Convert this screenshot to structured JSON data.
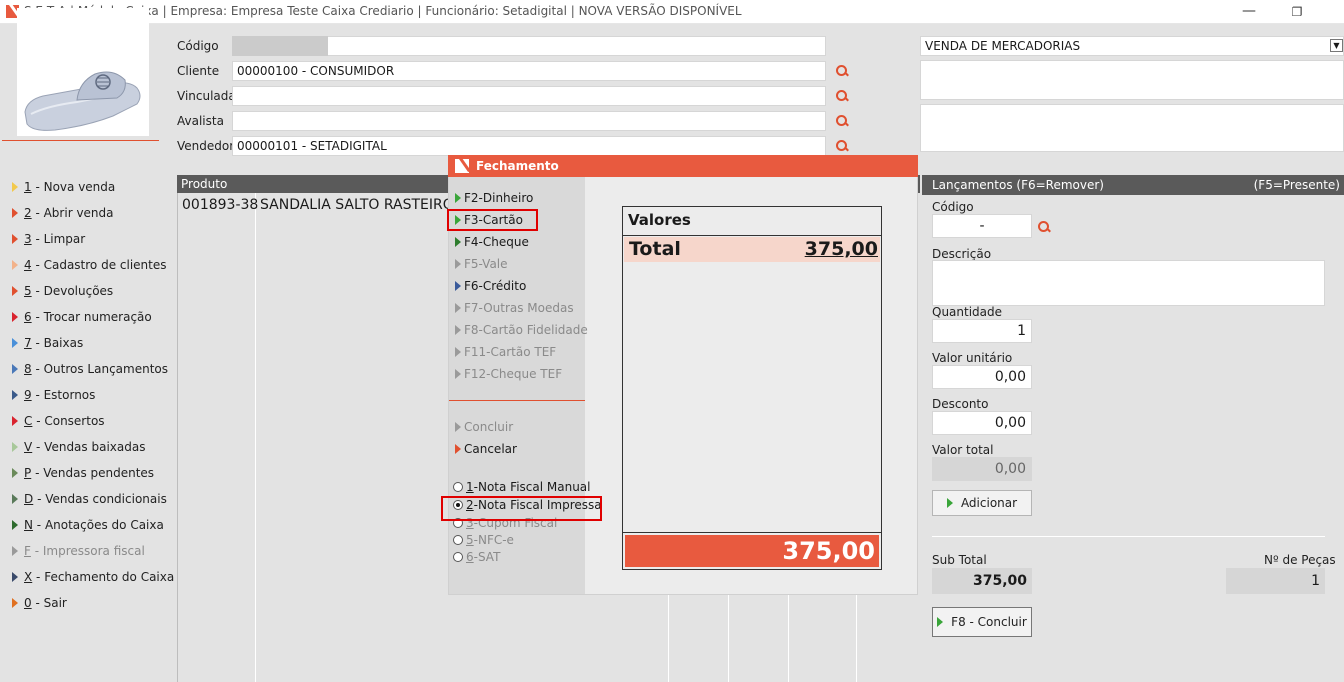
{
  "window": {
    "title": "S E T A | Módulo Caixa | Empresa: Empresa Teste Caixa Crediario | Funcionário: Setadigital  |  NOVA  VERSÃO  DISPONÍVEL",
    "minimize_glyph": "—",
    "restore_glyph": "❐"
  },
  "sidebar": {
    "items": [
      {
        "key": "1",
        "label": " - Nova venda",
        "color": "#f2c94c"
      },
      {
        "key": "2",
        "label": " - Abrir venda",
        "color": "#e0502f"
      },
      {
        "key": "3",
        "label": " - Limpar",
        "color": "#e0502f"
      },
      {
        "key": "4",
        "label": " - Cadastro de clientes",
        "color": "#f2b28a"
      },
      {
        "key": "5",
        "label": " - Devoluções",
        "color": "#e0502f"
      },
      {
        "key": "6",
        "label": " - Trocar numeração",
        "color": "#d9232e"
      },
      {
        "key": "7",
        "label": " - Baixas",
        "color": "#4a90d9"
      },
      {
        "key": "8",
        "label": " - Outros Lançamentos",
        "color": "#4a78b8"
      },
      {
        "key": "9",
        "label": " - Estornos",
        "color": "#3a5a8a"
      },
      {
        "key": "C",
        "label": " - Consertos",
        "color": "#d9232e"
      },
      {
        "key": "V",
        "label": " - Vendas baixadas",
        "color": "#a8c89a"
      },
      {
        "key": "P",
        "label": " - Vendas pendentes",
        "color": "#6a8a5a"
      },
      {
        "key": "D",
        "label": " - Vendas condicionais",
        "color": "#5a7a5a"
      },
      {
        "key": "N",
        "label": " - Anotações do Caixa",
        "color": "#2e6b2e"
      },
      {
        "key": "F",
        "label": " - Impressora fiscal",
        "color": "#9a9a9a",
        "disabled": true
      },
      {
        "key": "X",
        "label": " - Fechamento do Caixa",
        "color": "#3a4a6a"
      },
      {
        "key": "0",
        "label": " - Sair",
        "color": "#e07020"
      }
    ]
  },
  "form": {
    "codigo_label": "Código",
    "cliente_label": "Cliente",
    "cliente_value": "00000100 - CONSUMIDOR",
    "vinculada_label": "Vinculada",
    "avalista_label": "Avalista",
    "vendedor_label": "Vendedor",
    "vendedor_value": "00000101 - SETADIGITAL",
    "venda_tipo": "VENDA DE MERCADORIAS"
  },
  "grid": {
    "header": "Produto",
    "rows": [
      {
        "code": "001893-38",
        "description": "SANDALIA SALTO RASTEIRO"
      }
    ]
  },
  "lancamentos": {
    "header_left": "Lançamentos (F6=Remover)",
    "header_right": "(F5=Presente)",
    "codigo_label": "Código",
    "codigo_value": "-",
    "descricao_label": "Descrição",
    "quantidade_label": "Quantidade",
    "quantidade_value": "1",
    "valor_unitario_label": "Valor unitário",
    "valor_unitario_value": "0,00",
    "desconto_label": "Desconto",
    "desconto_value": "0,00",
    "valor_total_label": "Valor total",
    "valor_total_value": "0,00",
    "adicionar_label": "Adicionar",
    "subtotal_label": "Sub Total",
    "subtotal_value": "375,00",
    "pecas_label": "Nº de Peças",
    "pecas_value": "1",
    "concluir_label": "F8 - Concluir"
  },
  "modal": {
    "title": "Fechamento",
    "payments": [
      {
        "label": "F2-Dinheiro",
        "color": "#3aa53a",
        "disabled": false
      },
      {
        "label": "F3-Cartão",
        "color": "#3aa53a",
        "disabled": false
      },
      {
        "label": "F4-Cheque",
        "color": "#2e7d2e",
        "disabled": false
      },
      {
        "label": "F5-Vale",
        "color": "#9a9a9a",
        "disabled": true
      },
      {
        "label": "F6-Crédito",
        "color": "#3a5a9a",
        "disabled": false
      },
      {
        "label": "F7-Outras Moedas",
        "color": "#9a9a9a",
        "disabled": true
      },
      {
        "label": "F8-Cartão Fidelidade",
        "color": "#9a9a9a",
        "disabled": true
      },
      {
        "label": "F11-Cartão TEF",
        "color": "#9a9a9a",
        "disabled": true
      },
      {
        "label": "F12-Cheque TEF",
        "color": "#9a9a9a",
        "disabled": true
      }
    ],
    "concluir_label": "Concluir",
    "cancelar_label": "Cancelar",
    "doc_options": [
      {
        "key": "1",
        "label": "-Nota Fiscal Manual",
        "checked": false,
        "disabled": false
      },
      {
        "key": "2",
        "label": "-Nota Fiscal Impressa",
        "checked": true,
        "disabled": false
      },
      {
        "key": "3",
        "label": "-Cupom Fiscal",
        "checked": false,
        "disabled": true
      },
      {
        "key": "5",
        "label": "-NFC-e",
        "checked": false,
        "disabled": true
      },
      {
        "key": "6",
        "label": "-SAT",
        "checked": false,
        "disabled": true
      }
    ],
    "valores_title": "Valores",
    "total_label": "Total",
    "total_value": "375,00",
    "grand_total": "375,00"
  }
}
